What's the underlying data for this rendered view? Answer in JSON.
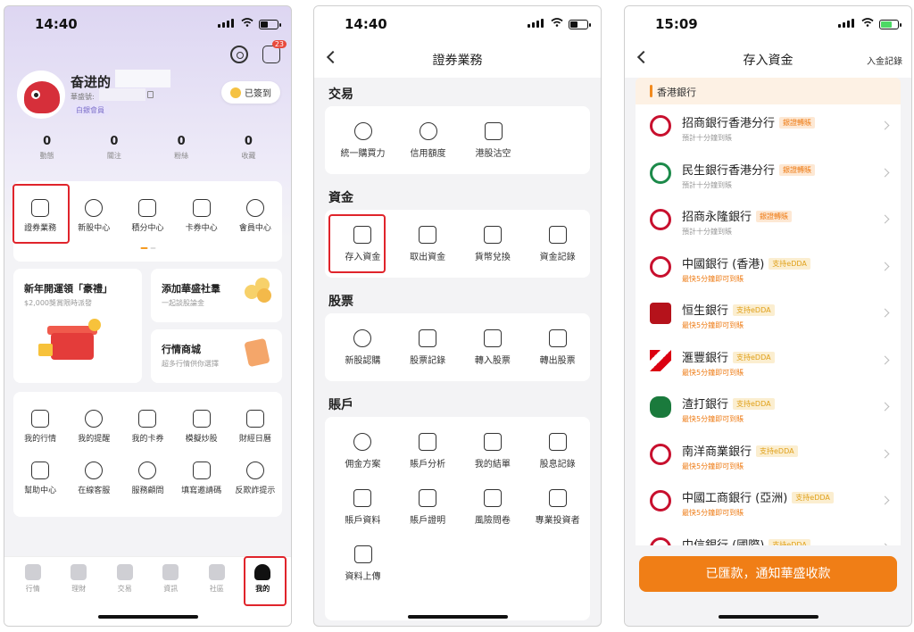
{
  "panel1": {
    "status_time": "14:40",
    "username": "奋进的",
    "uid_label": "華盛號:",
    "level": "白銀會員",
    "checkin_label": "已簽到",
    "mail_badge": "23",
    "stats": [
      {
        "value": "0",
        "label": "動態"
      },
      {
        "value": "0",
        "label": "關注"
      },
      {
        "value": "0",
        "label": "粉絲"
      },
      {
        "value": "0",
        "label": "收藏"
      }
    ],
    "quick": [
      "證券業務",
      "新股中心",
      "積分中心",
      "卡券中心",
      "會員中心"
    ],
    "promo_left": {
      "title": "新年開運領「豪禮」",
      "sub": "$2,000獎賞限時派發"
    },
    "promo_right_top": {
      "title": "添加華盛社羣",
      "sub": "一起談股論金"
    },
    "promo_right_bottom": {
      "title": "行情商城",
      "sub": "超多行情供你選擇"
    },
    "services_row1": [
      "我的行情",
      "我的提醒",
      "我的卡券",
      "模擬炒股",
      "財經日曆"
    ],
    "services_row2": [
      "幫助中心",
      "在線客服",
      "服務顧問",
      "填寫邀請碼",
      "反欺詐提示"
    ],
    "tabs": [
      "行情",
      "理財",
      "交易",
      "資訊",
      "社區",
      "我的"
    ]
  },
  "panel2": {
    "status_time": "14:40",
    "title": "證券業務",
    "sections": [
      {
        "title": "交易",
        "items": [
          "統一購買力",
          "信用額度",
          "港股沽空"
        ]
      },
      {
        "title": "資金",
        "items": [
          "存入資金",
          "取出資金",
          "貨幣兌換",
          "資金記錄"
        ]
      },
      {
        "title": "股票",
        "items": [
          "新股認購",
          "股票記錄",
          "轉入股票",
          "轉出股票"
        ]
      },
      {
        "title": "賬戶",
        "items": [
          "佣金方案",
          "賬戶分析",
          "我的結單",
          "股息記錄",
          "賬戶資料",
          "賬戶證明",
          "風險問卷",
          "專業投資者",
          "資料上傳"
        ]
      }
    ]
  },
  "panel3": {
    "status_time": "15:09",
    "title": "存入資金",
    "right_link": "入金記錄",
    "section": "香港銀行",
    "banks": [
      {
        "name": "招商銀行香港分行",
        "tag": "銀證轉賬",
        "sub": "預計十分鐘到賬",
        "logo": "cmb-logo"
      },
      {
        "name": "民生銀行香港分行",
        "tag": "銀證轉賬",
        "sub": "預計十分鐘到賬",
        "logo": "cmbc-logo"
      },
      {
        "name": "招商永隆銀行",
        "tag": "銀證轉賬",
        "sub": "預計十分鐘到賬",
        "logo": "cmbwl-logo"
      },
      {
        "name": "中國銀行 (香港)",
        "tag": "支持eDDA",
        "sub": "最快5分鐘即可到賬",
        "logo": "boc-logo"
      },
      {
        "name": "恒生銀行",
        "tag": "支持eDDA",
        "sub": "最快5分鐘即可到賬",
        "logo": "hangseng-logo"
      },
      {
        "name": "滙豐銀行",
        "tag": "支持eDDA",
        "sub": "最快5分鐘即可到賬",
        "logo": "hsbc-logo"
      },
      {
        "name": "渣打銀行",
        "tag": "支持eDDA",
        "sub": "最快5分鐘即可到賬",
        "logo": "sc-logo"
      },
      {
        "name": "南洋商業銀行",
        "tag": "支持eDDA",
        "sub": "最快5分鐘即可到賬",
        "logo": "nanyang-logo"
      },
      {
        "name": "中國工商銀行 (亞洲)",
        "tag": "支持eDDA",
        "sub": "最快5分鐘即可到賬",
        "logo": "icbc-logo"
      },
      {
        "name": "中信銀行 (國際)",
        "tag": "支持eDDA",
        "sub": "",
        "logo": "citic-logo"
      }
    ],
    "cta": "已匯款，通知華盛收款"
  }
}
